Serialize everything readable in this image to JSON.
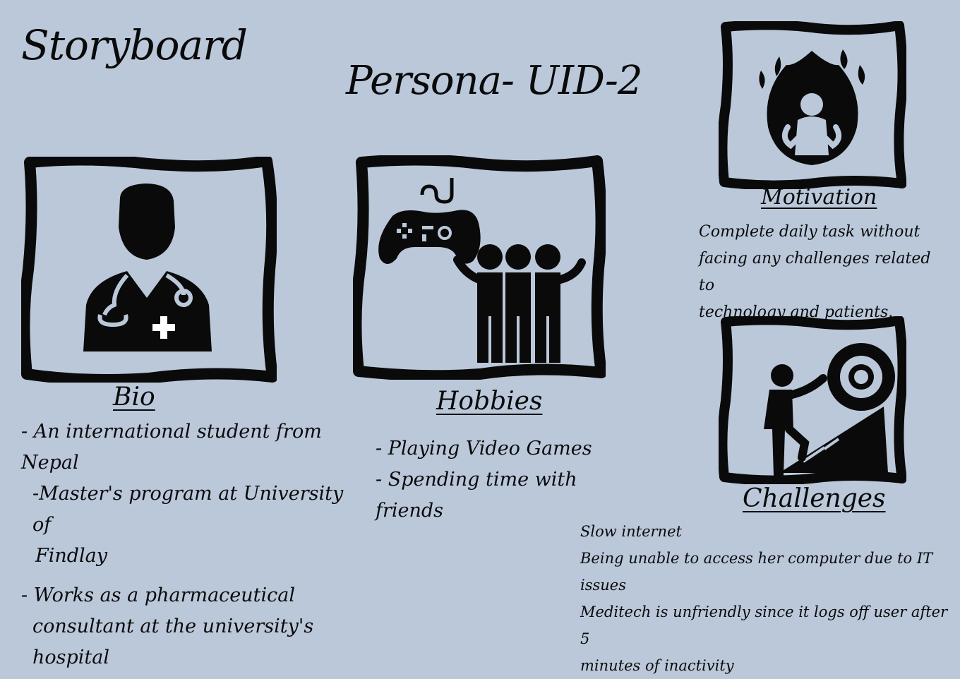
{
  "header": {
    "title": "Storyboard",
    "persona": "Persona- UID-2"
  },
  "bio": {
    "heading": "Bio",
    "items": [
      "- An international student from Nepal",
      "-Master's program at University of",
      "Findlay",
      "- Works as a pharmaceutical",
      "consultant at the university's",
      "hospital"
    ],
    "icon": "doctor-icon"
  },
  "hobbies": {
    "heading": "Hobbies",
    "items": [
      "- Playing Video Games",
      "- Spending time with",
      "friends"
    ],
    "icon": "game-controller-friends-icon"
  },
  "motivation": {
    "heading": "Motivation",
    "lines": [
      "Complete daily task without",
      "facing any challenges related to",
      "technology and patients."
    ],
    "icon": "flame-strength-icon"
  },
  "challenges": {
    "heading": "Challenges",
    "lines": [
      "Slow internet",
      "Being unable to access her computer due to IT issues",
      "Meditech is unfriendly since it logs off user after 5",
      "minutes of inactivity"
    ],
    "icon": "climbing-gear-icon"
  },
  "colors": {
    "background": "#bac8da",
    "ink": "#0a0a0a"
  }
}
